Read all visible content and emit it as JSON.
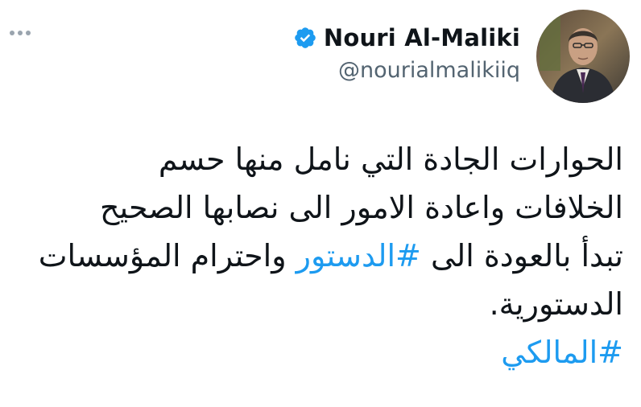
{
  "author": {
    "name": "Nouri Al-Maliki",
    "handle": "@nourialmalikiiq"
  },
  "icons": {
    "more": "more-horizontal-icon",
    "verified": "verified-badge-icon"
  },
  "tweet": {
    "line1": "الحوارات الجادة التي نامل منها حسم",
    "line2": "الخلافات واعادة الامور الى نصابها الصحيح",
    "line3_before": "تبدأ بالعودة الى ",
    "line3_hashtag": "#الدستور",
    "line3_after": " واحترام المؤسسات",
    "line4": "الدستورية.",
    "hashtag2": "#المالكي"
  },
  "colors": {
    "link": "#1d9bf0",
    "verified": "#1d9bf0",
    "secondary_text": "#536471"
  }
}
